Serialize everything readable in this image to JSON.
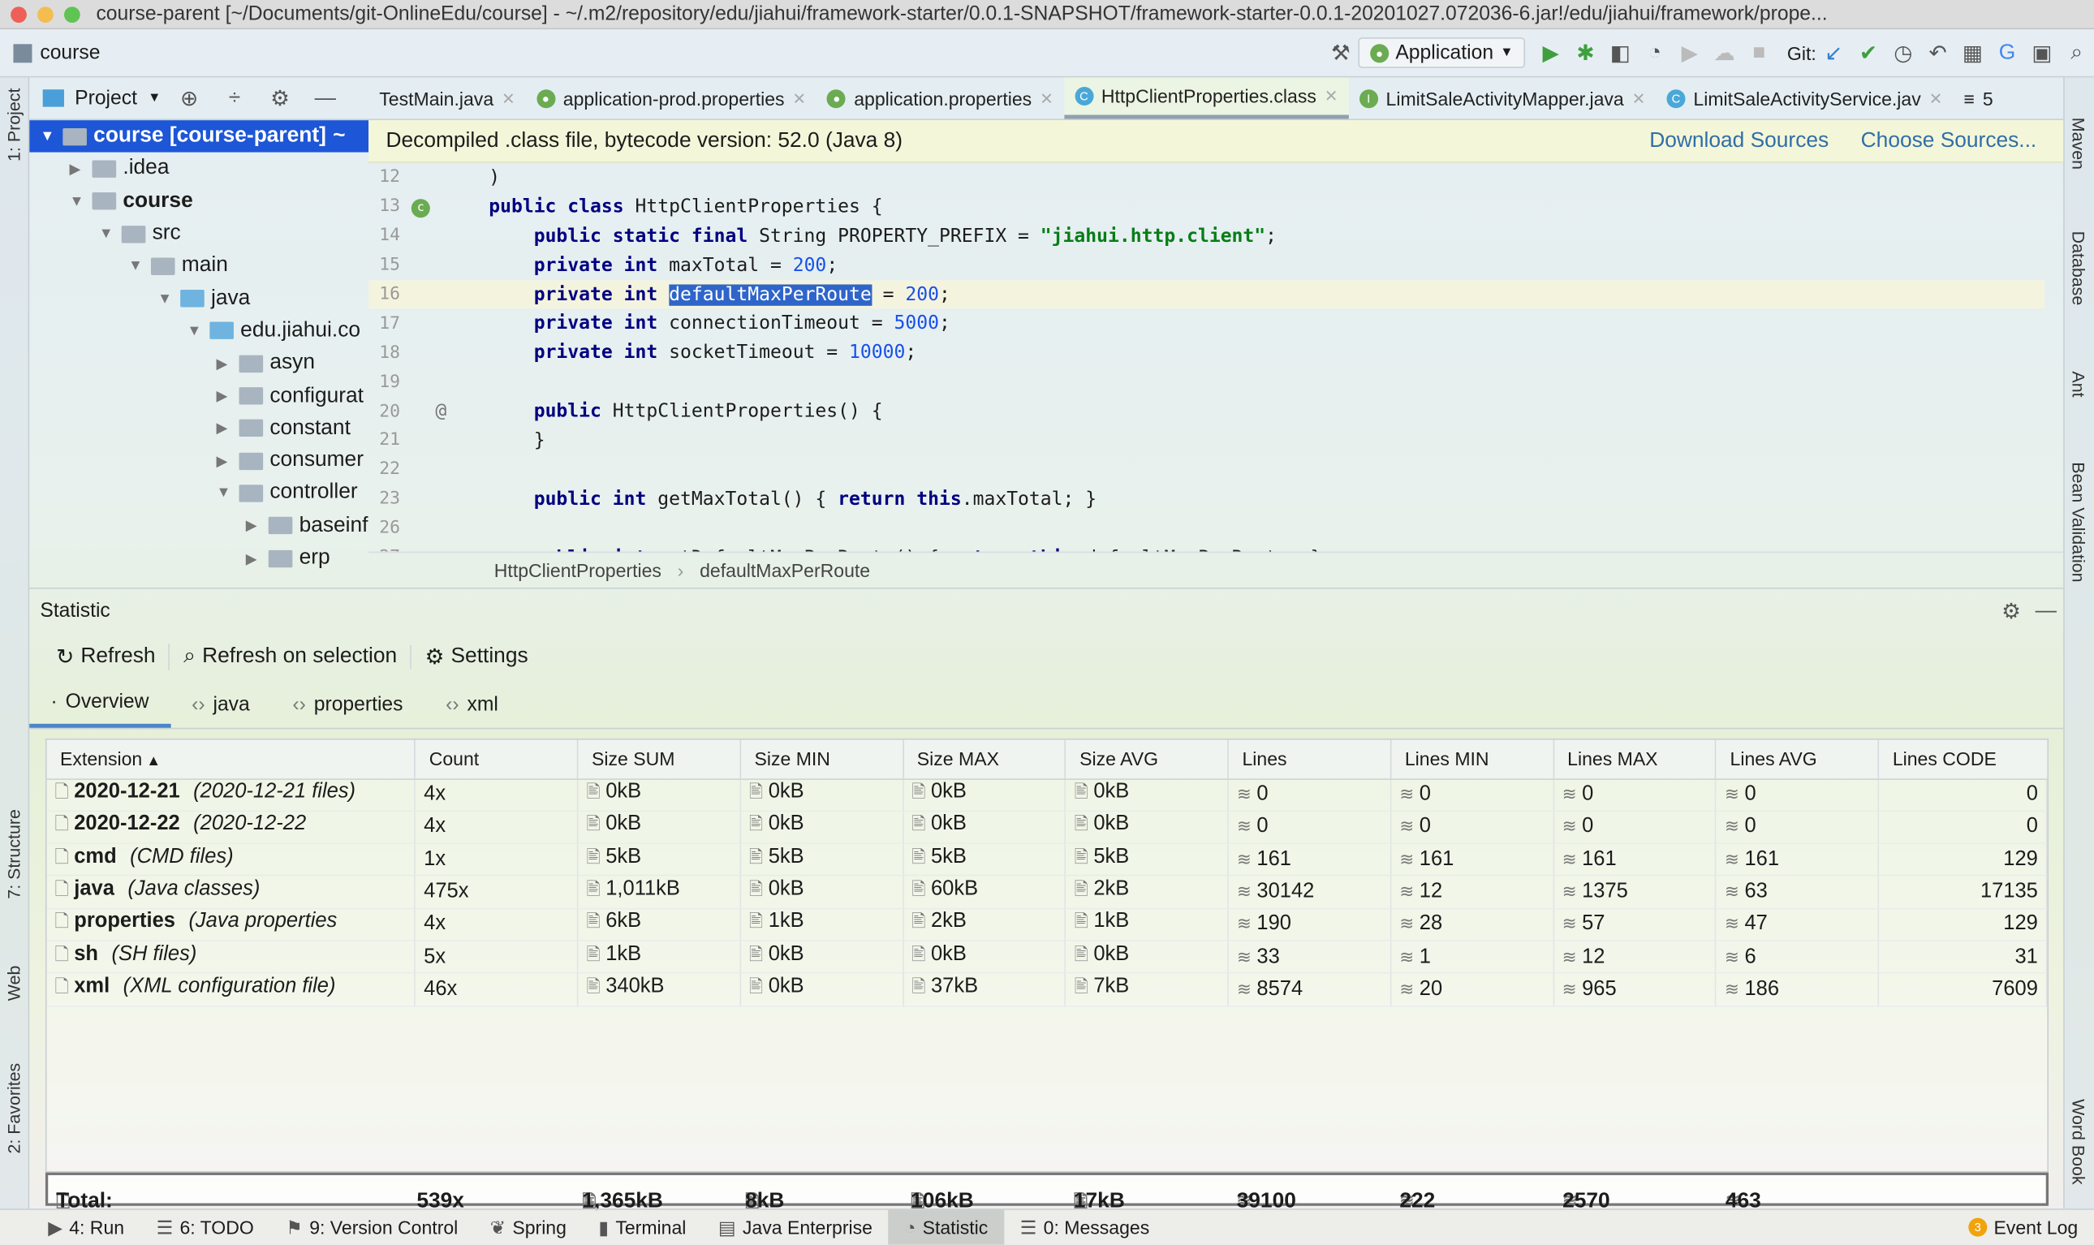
{
  "window": {
    "title": "course-parent [~/Documents/git-OnlineEdu/course] - ~/.m2/repository/edu/jiahui/framework-starter/0.0.1-SNAPSHOT/framework-starter-0.0.1-20201027.072036-6.jar!/edu/jiahui/framework/prope..."
  },
  "toolbar": {
    "project": "course",
    "run_config": "Application",
    "git_label": "Git:"
  },
  "left_stripe": [
    "1: Project",
    "7: Structure",
    "Web",
    "2: Favorites"
  ],
  "right_stripe": [
    "Maven",
    "Database",
    "Ant",
    "Bean Validation",
    "Word Book"
  ],
  "project_panel": {
    "label": "Project"
  },
  "tabs": [
    {
      "label": "TestMain.java",
      "icon": "java"
    },
    {
      "label": "application-prod.properties",
      "icon": "spring"
    },
    {
      "label": "application.properties",
      "icon": "spring"
    },
    {
      "label": "HttpClientProperties.class",
      "icon": "class",
      "active": true
    },
    {
      "label": "LimitSaleActivityMapper.java",
      "icon": "interface"
    },
    {
      "label": "LimitSaleActivityService.jav",
      "icon": "class"
    }
  ],
  "tabs_overflow": "5",
  "tree": [
    {
      "label": "course [course-parent]",
      "suffix": "~",
      "level": 0,
      "open": true,
      "selected": true
    },
    {
      "label": ".idea",
      "level": 1,
      "open": false
    },
    {
      "label": "course",
      "level": 1,
      "open": true,
      "bold": true
    },
    {
      "label": "src",
      "level": 2,
      "open": true
    },
    {
      "label": "main",
      "level": 3,
      "open": true
    },
    {
      "label": "java",
      "level": 4,
      "open": true
    },
    {
      "label": "edu.jiahui.co",
      "level": 5,
      "open": true
    },
    {
      "label": "asyn",
      "level": 6,
      "open": false
    },
    {
      "label": "configurat",
      "level": 6,
      "open": false
    },
    {
      "label": "constant",
      "level": 6,
      "open": false
    },
    {
      "label": "consumer",
      "level": 6,
      "open": false
    },
    {
      "label": "controller",
      "level": 6,
      "open": true
    },
    {
      "label": "baseinf",
      "level": 7,
      "open": false
    },
    {
      "label": "erp",
      "level": 7,
      "open": false
    }
  ],
  "banner": {
    "text": "Decompiled .class file, bytecode version: 52.0 (Java 8)",
    "download": "Download Sources",
    "choose": "Choose Sources..."
  },
  "code": [
    {
      "n": "12",
      "t": [
        [
          "",
          ")"
        ]
      ]
    },
    {
      "n": "13",
      "t": [
        [
          "kw",
          "public class "
        ],
        [
          "",
          "HttpClientProperties {"
        ]
      ]
    },
    {
      "n": "14",
      "t": [
        [
          "",
          "    "
        ],
        [
          "kw",
          "public static final "
        ],
        [
          "",
          "String PROPERTY_PREFIX = "
        ],
        [
          "str",
          "\"jiahui.http.client\""
        ],
        [
          "",
          ";"
        ]
      ]
    },
    {
      "n": "15",
      "t": [
        [
          "",
          "    "
        ],
        [
          "kw",
          "private int "
        ],
        [
          "",
          "maxTotal = "
        ],
        [
          "num",
          "200"
        ],
        [
          "",
          ";"
        ]
      ]
    },
    {
      "n": "16",
      "cur": true,
      "t": [
        [
          "",
          "    "
        ],
        [
          "kw",
          "private int "
        ],
        [
          "hl",
          "defaultMaxPerRoute"
        ],
        [
          "",
          " = "
        ],
        [
          "num",
          "200"
        ],
        [
          "",
          ";"
        ]
      ]
    },
    {
      "n": "17",
      "t": [
        [
          "",
          "    "
        ],
        [
          "kw",
          "private int "
        ],
        [
          "",
          "connectionTimeout = "
        ],
        [
          "num",
          "5000"
        ],
        [
          "",
          ";"
        ]
      ]
    },
    {
      "n": "18",
      "t": [
        [
          "",
          "    "
        ],
        [
          "kw",
          "private int "
        ],
        [
          "",
          "socketTimeout = "
        ],
        [
          "num",
          "10000"
        ],
        [
          "",
          ";"
        ]
      ]
    },
    {
      "n": "19",
      "t": []
    },
    {
      "n": "20",
      "t": [
        [
          "",
          "    "
        ],
        [
          "kw",
          "public "
        ],
        [
          "",
          "HttpClientProperties() {"
        ]
      ]
    },
    {
      "n": "21",
      "t": [
        [
          "",
          "    }"
        ]
      ]
    },
    {
      "n": "22",
      "t": []
    },
    {
      "n": "23",
      "t": [
        [
          "",
          "    "
        ],
        [
          "kw",
          "public int "
        ],
        [
          "",
          "getMaxTotal() { "
        ],
        [
          "kw",
          "return this"
        ],
        [
          "",
          ".maxTotal; }"
        ]
      ]
    },
    {
      "n": "26",
      "t": []
    },
    {
      "n": "27",
      "t": [
        [
          "",
          "    "
        ],
        [
          "kw",
          "public int "
        ],
        [
          "",
          "getDefaultMaxPerRoute() { "
        ],
        [
          "kw",
          "return this"
        ],
        [
          "",
          ".defaultMaxPerRoute; }"
        ]
      ]
    }
  ],
  "breadcrumb": [
    "HttpClientProperties",
    "defaultMaxPerRoute"
  ],
  "statistic": {
    "title": "Statistic",
    "tools": [
      "Refresh",
      "Refresh on selection",
      "Settings"
    ],
    "tabs": [
      "Overview",
      "java",
      "properties",
      "xml"
    ],
    "columns": [
      "Extension",
      "Count",
      "Size SUM",
      "Size MIN",
      "Size MAX",
      "Size AVG",
      "Lines",
      "Lines MIN",
      "Lines MAX",
      "Lines AVG",
      "Lines CODE"
    ],
    "rows": [
      [
        "2020-12-21",
        "(2020-12-21 files)",
        "4x",
        "0kB",
        "0kB",
        "0kB",
        "0kB",
        "0",
        "0",
        "0",
        "0",
        "0"
      ],
      [
        "2020-12-22",
        "(2020-12-22",
        "4x",
        "0kB",
        "0kB",
        "0kB",
        "0kB",
        "0",
        "0",
        "0",
        "0",
        "0"
      ],
      [
        "cmd",
        "(CMD files)",
        "1x",
        "5kB",
        "5kB",
        "5kB",
        "5kB",
        "161",
        "161",
        "161",
        "161",
        "129"
      ],
      [
        "java",
        "(Java classes)",
        "475x",
        "1,011kB",
        "0kB",
        "60kB",
        "2kB",
        "30142",
        "12",
        "1375",
        "63",
        "17135"
      ],
      [
        "properties",
        "(Java properties",
        "4x",
        "6kB",
        "1kB",
        "2kB",
        "1kB",
        "190",
        "28",
        "57",
        "47",
        "129"
      ],
      [
        "sh",
        "(SH files)",
        "5x",
        "1kB",
        "0kB",
        "0kB",
        "0kB",
        "33",
        "1",
        "12",
        "6",
        "31"
      ],
      [
        "xml",
        "(XML configuration file)",
        "46x",
        "340kB",
        "0kB",
        "37kB",
        "7kB",
        "8574",
        "20",
        "965",
        "186",
        "7609"
      ]
    ],
    "total": [
      "Total:",
      "539x",
      "1,365kB",
      "8kB",
      "106kB",
      "17kB",
      "39100",
      "222",
      "2570",
      "463"
    ]
  },
  "bottom_bar": [
    {
      "label": "4: Run"
    },
    {
      "label": "6: TODO"
    },
    {
      "label": "9: Version Control"
    },
    {
      "label": "Spring"
    },
    {
      "label": "Terminal"
    },
    {
      "label": "Java Enterprise"
    },
    {
      "label": "Statistic",
      "active": true
    },
    {
      "label": "0: Messages"
    }
  ],
  "event_log": {
    "count": "3",
    "label": "Event Log"
  },
  "colors": {
    "selection": "#1d56d6",
    "link": "#2f6ea9",
    "keyword": "#000080",
    "string": "#067d17",
    "number": "#1750eb"
  }
}
